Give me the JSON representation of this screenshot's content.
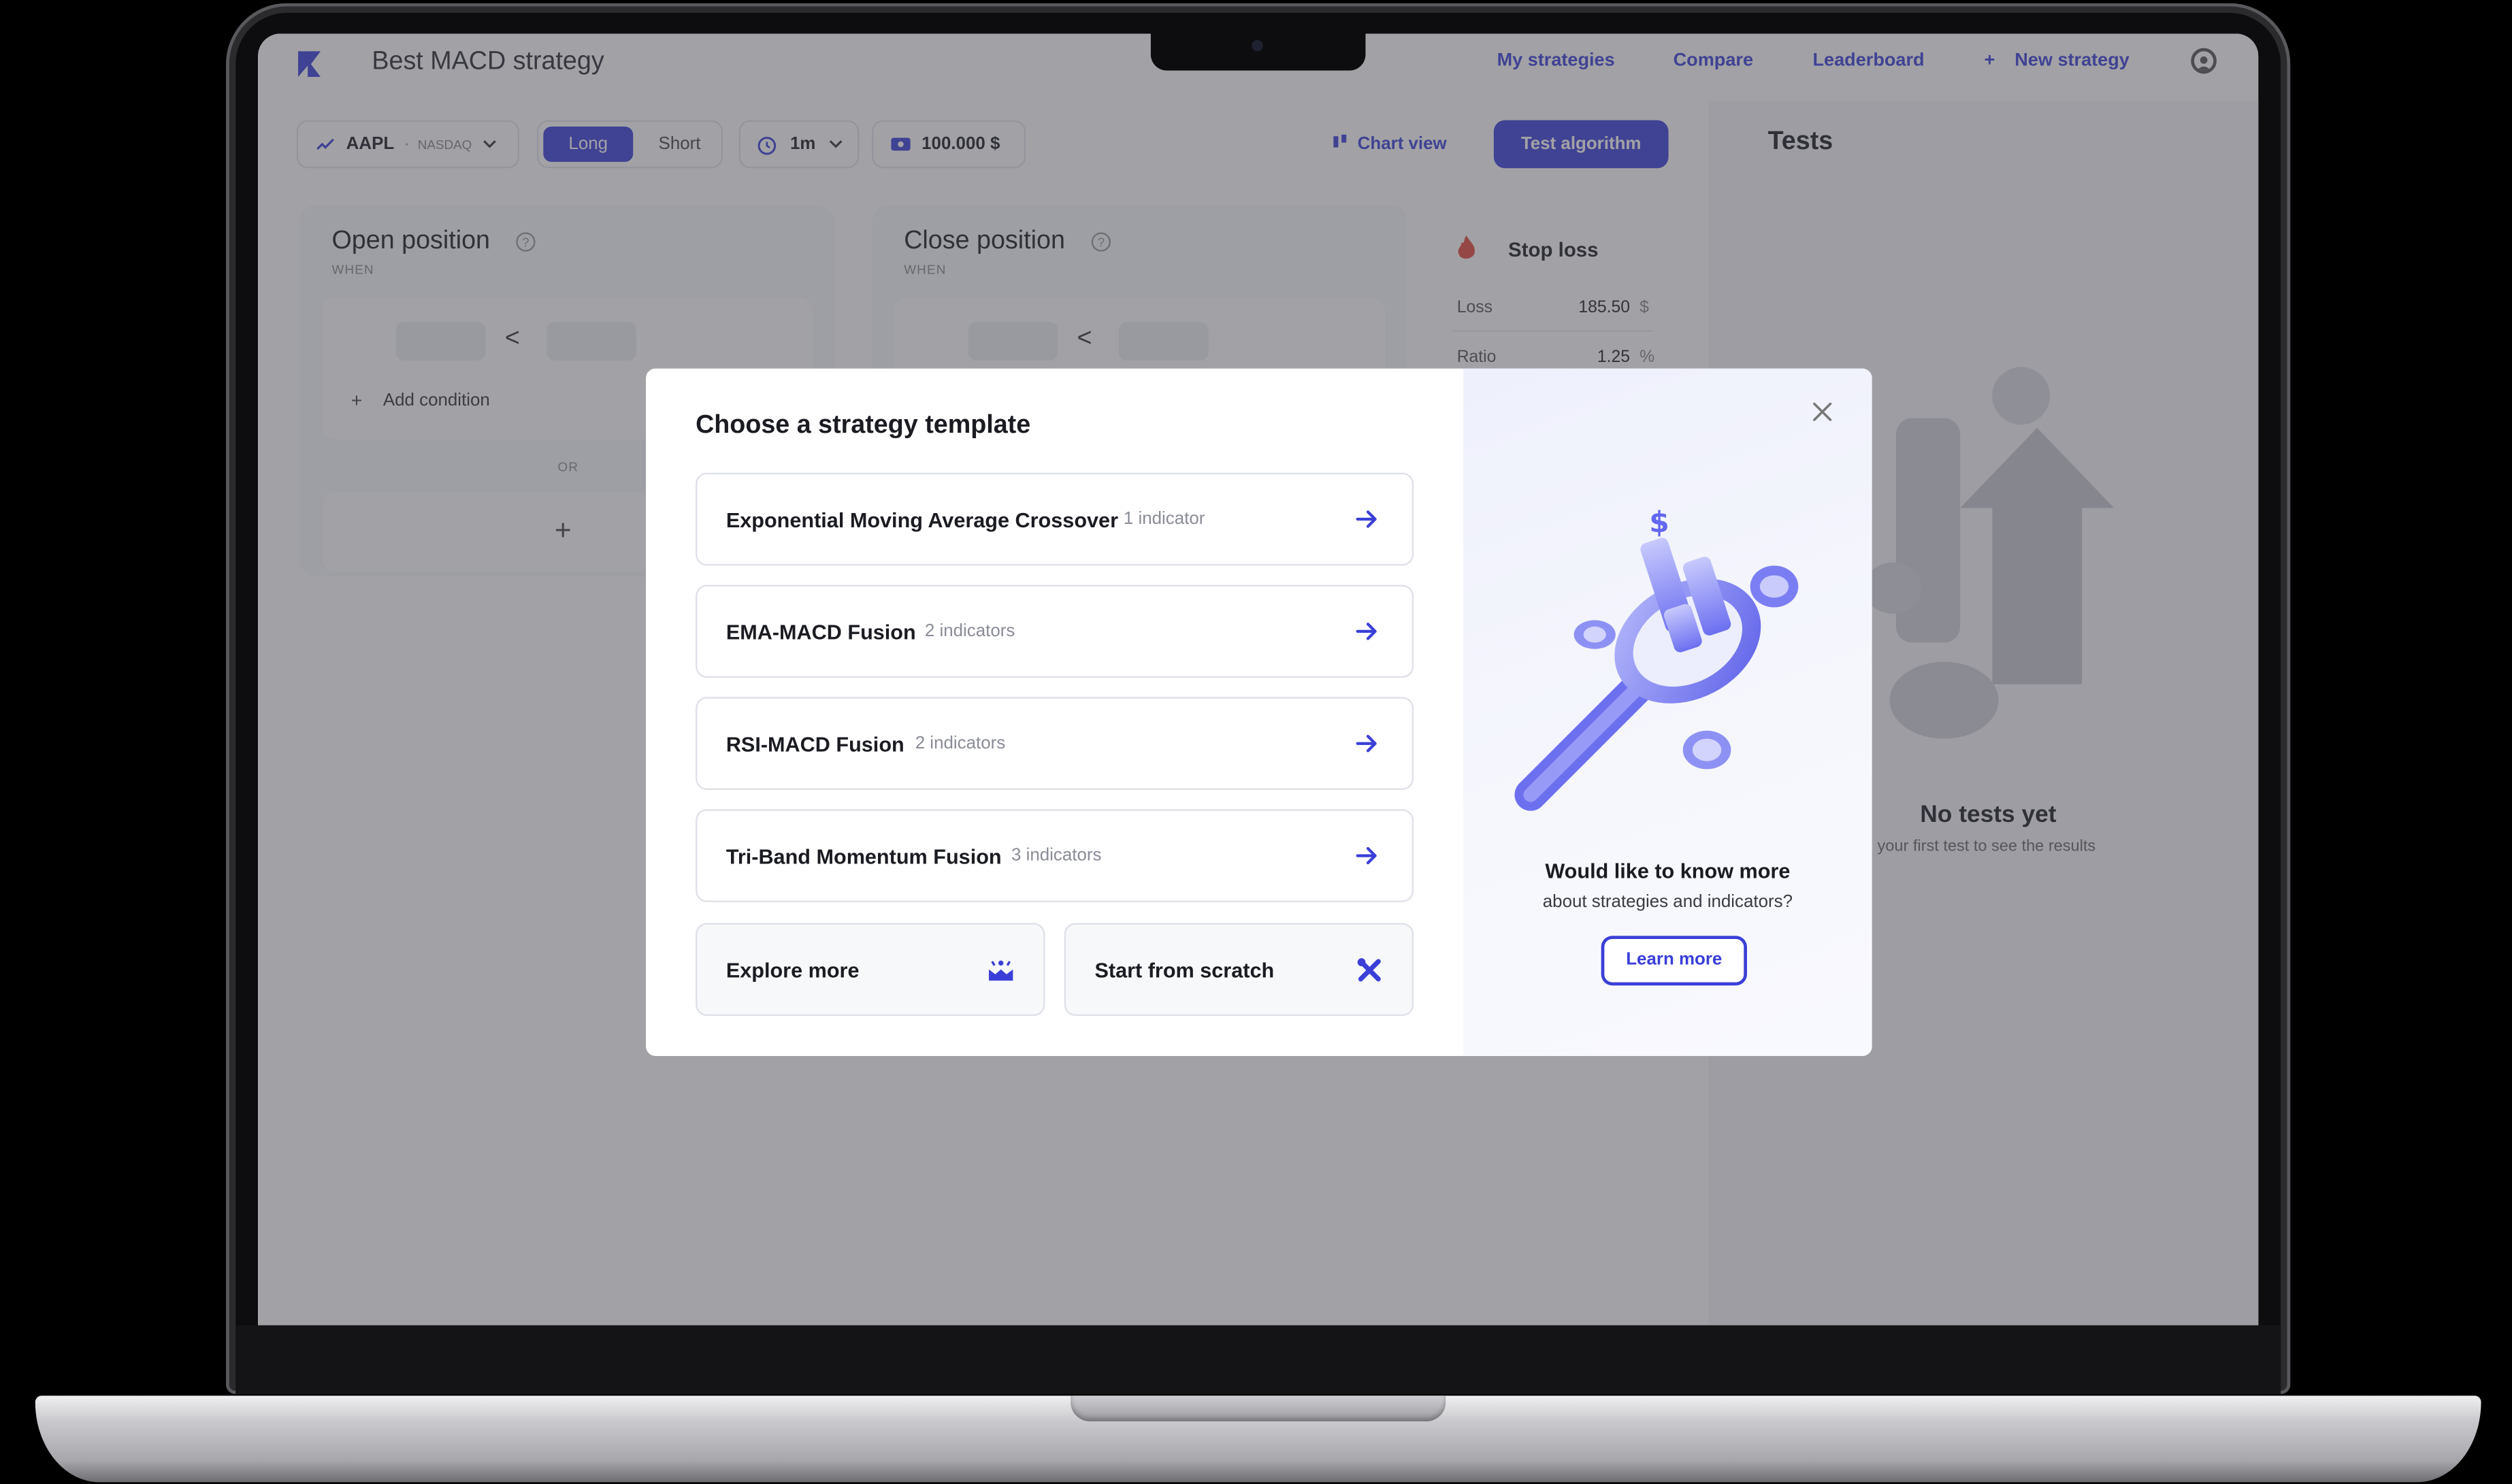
{
  "app": {
    "title": "Best MACD strategy",
    "nav": [
      "My strategies",
      "Compare",
      "Leaderboard",
      "New strategy"
    ],
    "accent_color": "#3b3fd8"
  },
  "toolbar": {
    "symbol": "AAPL",
    "exchange": "NASDAQ",
    "direction_options": [
      "Long",
      "Short"
    ],
    "direction_selected": "Long",
    "timeframe": "1m",
    "capital": "100.000 $",
    "chart_view": "Chart view",
    "test_button": "Test algorithm"
  },
  "open_position": {
    "title": "Open position",
    "when": "WHEN",
    "operator": "<",
    "add_condition": "Add condition",
    "or": "OR"
  },
  "close_position": {
    "title": "Close position",
    "when": "WHEN",
    "operator": "<"
  },
  "stop_loss": {
    "title": "Stop loss",
    "loss_label": "Loss",
    "loss_value": "185.50",
    "loss_unit": "$",
    "ratio_label": "Ratio",
    "ratio_value": "1.25",
    "ratio_unit": "%"
  },
  "tests": {
    "title": "Tests",
    "empty_title": "No tests yet",
    "empty_sub": "n your first test to see the results"
  },
  "modal": {
    "title": "Choose a strategy template",
    "templates": [
      {
        "name": "Exponential Moving Average Crossover",
        "count": "1 indicator"
      },
      {
        "name": "EMA-MACD Fusion",
        "count": "2 indicators"
      },
      {
        "name": "RSI-MACD Fusion",
        "count": "2 indicators"
      },
      {
        "name": "Tri-Band Momentum Fusion",
        "count": "3 indicators"
      }
    ],
    "explore_more": "Explore more",
    "start_from_scratch": "Start from scratch",
    "side_heading": "Would like to know more",
    "side_sub": "about strategies and indicators?",
    "learn_more": "Learn more"
  }
}
